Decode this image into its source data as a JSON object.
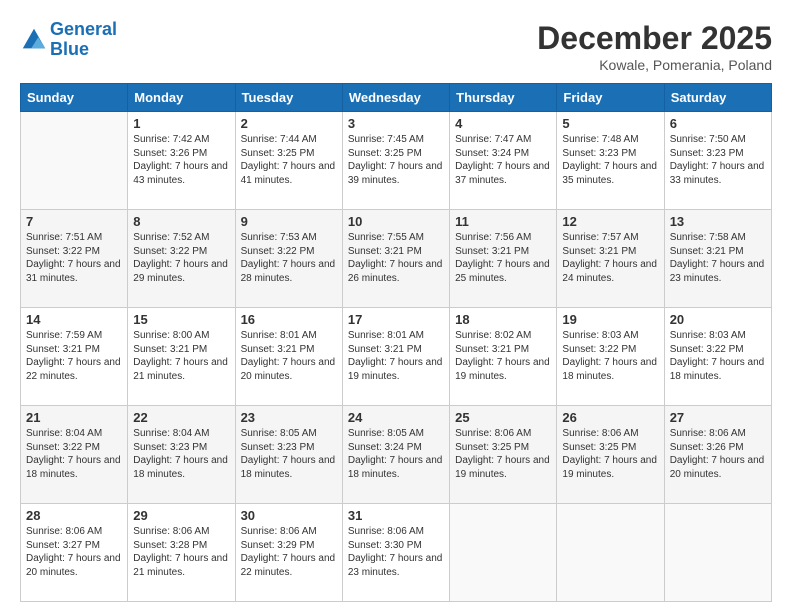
{
  "header": {
    "logo_line1": "General",
    "logo_line2": "Blue",
    "month_year": "December 2025",
    "location": "Kowale, Pomerania, Poland"
  },
  "weekdays": [
    "Sunday",
    "Monday",
    "Tuesday",
    "Wednesday",
    "Thursday",
    "Friday",
    "Saturday"
  ],
  "weeks": [
    [
      {
        "day": "",
        "sunrise": "",
        "sunset": "",
        "daylight": ""
      },
      {
        "day": "1",
        "sunrise": "Sunrise: 7:42 AM",
        "sunset": "Sunset: 3:26 PM",
        "daylight": "Daylight: 7 hours and 43 minutes."
      },
      {
        "day": "2",
        "sunrise": "Sunrise: 7:44 AM",
        "sunset": "Sunset: 3:25 PM",
        "daylight": "Daylight: 7 hours and 41 minutes."
      },
      {
        "day": "3",
        "sunrise": "Sunrise: 7:45 AM",
        "sunset": "Sunset: 3:25 PM",
        "daylight": "Daylight: 7 hours and 39 minutes."
      },
      {
        "day": "4",
        "sunrise": "Sunrise: 7:47 AM",
        "sunset": "Sunset: 3:24 PM",
        "daylight": "Daylight: 7 hours and 37 minutes."
      },
      {
        "day": "5",
        "sunrise": "Sunrise: 7:48 AM",
        "sunset": "Sunset: 3:23 PM",
        "daylight": "Daylight: 7 hours and 35 minutes."
      },
      {
        "day": "6",
        "sunrise": "Sunrise: 7:50 AM",
        "sunset": "Sunset: 3:23 PM",
        "daylight": "Daylight: 7 hours and 33 minutes."
      }
    ],
    [
      {
        "day": "7",
        "sunrise": "Sunrise: 7:51 AM",
        "sunset": "Sunset: 3:22 PM",
        "daylight": "Daylight: 7 hours and 31 minutes."
      },
      {
        "day": "8",
        "sunrise": "Sunrise: 7:52 AM",
        "sunset": "Sunset: 3:22 PM",
        "daylight": "Daylight: 7 hours and 29 minutes."
      },
      {
        "day": "9",
        "sunrise": "Sunrise: 7:53 AM",
        "sunset": "Sunset: 3:22 PM",
        "daylight": "Daylight: 7 hours and 28 minutes."
      },
      {
        "day": "10",
        "sunrise": "Sunrise: 7:55 AM",
        "sunset": "Sunset: 3:21 PM",
        "daylight": "Daylight: 7 hours and 26 minutes."
      },
      {
        "day": "11",
        "sunrise": "Sunrise: 7:56 AM",
        "sunset": "Sunset: 3:21 PM",
        "daylight": "Daylight: 7 hours and 25 minutes."
      },
      {
        "day": "12",
        "sunrise": "Sunrise: 7:57 AM",
        "sunset": "Sunset: 3:21 PM",
        "daylight": "Daylight: 7 hours and 24 minutes."
      },
      {
        "day": "13",
        "sunrise": "Sunrise: 7:58 AM",
        "sunset": "Sunset: 3:21 PM",
        "daylight": "Daylight: 7 hours and 23 minutes."
      }
    ],
    [
      {
        "day": "14",
        "sunrise": "Sunrise: 7:59 AM",
        "sunset": "Sunset: 3:21 PM",
        "daylight": "Daylight: 7 hours and 22 minutes."
      },
      {
        "day": "15",
        "sunrise": "Sunrise: 8:00 AM",
        "sunset": "Sunset: 3:21 PM",
        "daylight": "Daylight: 7 hours and 21 minutes."
      },
      {
        "day": "16",
        "sunrise": "Sunrise: 8:01 AM",
        "sunset": "Sunset: 3:21 PM",
        "daylight": "Daylight: 7 hours and 20 minutes."
      },
      {
        "day": "17",
        "sunrise": "Sunrise: 8:01 AM",
        "sunset": "Sunset: 3:21 PM",
        "daylight": "Daylight: 7 hours and 19 minutes."
      },
      {
        "day": "18",
        "sunrise": "Sunrise: 8:02 AM",
        "sunset": "Sunset: 3:21 PM",
        "daylight": "Daylight: 7 hours and 19 minutes."
      },
      {
        "day": "19",
        "sunrise": "Sunrise: 8:03 AM",
        "sunset": "Sunset: 3:22 PM",
        "daylight": "Daylight: 7 hours and 18 minutes."
      },
      {
        "day": "20",
        "sunrise": "Sunrise: 8:03 AM",
        "sunset": "Sunset: 3:22 PM",
        "daylight": "Daylight: 7 hours and 18 minutes."
      }
    ],
    [
      {
        "day": "21",
        "sunrise": "Sunrise: 8:04 AM",
        "sunset": "Sunset: 3:22 PM",
        "daylight": "Daylight: 7 hours and 18 minutes."
      },
      {
        "day": "22",
        "sunrise": "Sunrise: 8:04 AM",
        "sunset": "Sunset: 3:23 PM",
        "daylight": "Daylight: 7 hours and 18 minutes."
      },
      {
        "day": "23",
        "sunrise": "Sunrise: 8:05 AM",
        "sunset": "Sunset: 3:23 PM",
        "daylight": "Daylight: 7 hours and 18 minutes."
      },
      {
        "day": "24",
        "sunrise": "Sunrise: 8:05 AM",
        "sunset": "Sunset: 3:24 PM",
        "daylight": "Daylight: 7 hours and 18 minutes."
      },
      {
        "day": "25",
        "sunrise": "Sunrise: 8:06 AM",
        "sunset": "Sunset: 3:25 PM",
        "daylight": "Daylight: 7 hours and 19 minutes."
      },
      {
        "day": "26",
        "sunrise": "Sunrise: 8:06 AM",
        "sunset": "Sunset: 3:25 PM",
        "daylight": "Daylight: 7 hours and 19 minutes."
      },
      {
        "day": "27",
        "sunrise": "Sunrise: 8:06 AM",
        "sunset": "Sunset: 3:26 PM",
        "daylight": "Daylight: 7 hours and 20 minutes."
      }
    ],
    [
      {
        "day": "28",
        "sunrise": "Sunrise: 8:06 AM",
        "sunset": "Sunset: 3:27 PM",
        "daylight": "Daylight: 7 hours and 20 minutes."
      },
      {
        "day": "29",
        "sunrise": "Sunrise: 8:06 AM",
        "sunset": "Sunset: 3:28 PM",
        "daylight": "Daylight: 7 hours and 21 minutes."
      },
      {
        "day": "30",
        "sunrise": "Sunrise: 8:06 AM",
        "sunset": "Sunset: 3:29 PM",
        "daylight": "Daylight: 7 hours and 22 minutes."
      },
      {
        "day": "31",
        "sunrise": "Sunrise: 8:06 AM",
        "sunset": "Sunset: 3:30 PM",
        "daylight": "Daylight: 7 hours and 23 minutes."
      },
      {
        "day": "",
        "sunrise": "",
        "sunset": "",
        "daylight": ""
      },
      {
        "day": "",
        "sunrise": "",
        "sunset": "",
        "daylight": ""
      },
      {
        "day": "",
        "sunrise": "",
        "sunset": "",
        "daylight": ""
      }
    ]
  ]
}
